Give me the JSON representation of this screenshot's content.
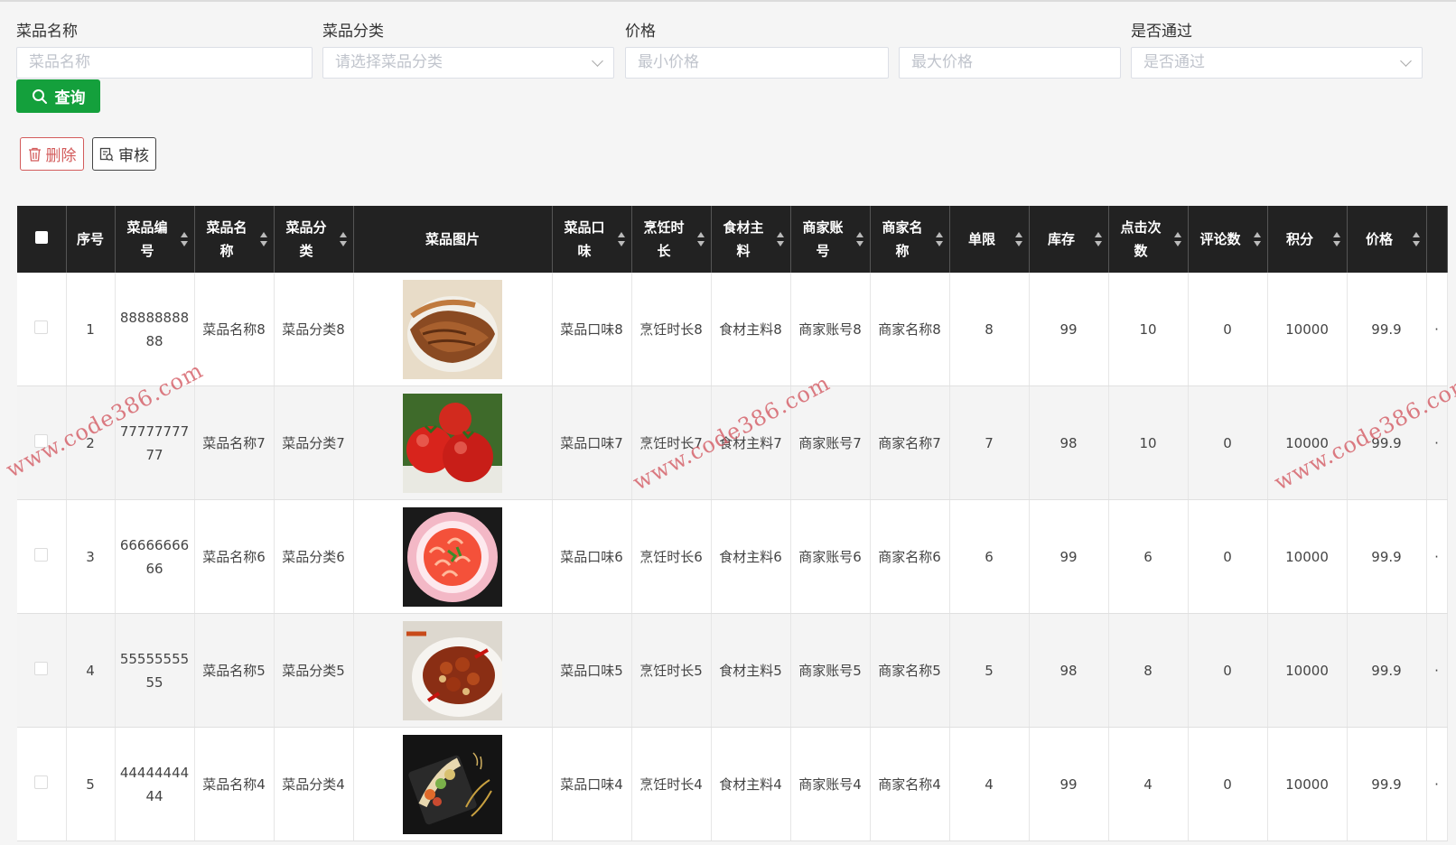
{
  "search": {
    "fields": [
      {
        "label": "菜品名称",
        "placeholder": "菜品名称"
      },
      {
        "label": "菜品分类",
        "placeholder": "请选择菜品分类"
      },
      {
        "label": "价格",
        "placeholder_min": "最小价格",
        "placeholder_max": "最大价格"
      },
      {
        "label": "是否通过",
        "placeholder": "是否通过"
      }
    ],
    "search_button": "查询"
  },
  "actions": {
    "delete": "删除",
    "audit": "审核"
  },
  "table": {
    "headers": [
      "序号",
      "菜品编号",
      "菜品名称",
      "菜品分类",
      "菜品图片",
      "菜品口味",
      "烹饪时长",
      "食材主料",
      "商家账号",
      "商家名称",
      "单限",
      "库存",
      "点击次数",
      "评论数",
      "积分",
      "价格"
    ],
    "rows": [
      {
        "index": "1",
        "code": "8888888888",
        "name": "菜品名称8",
        "category": "菜品分类8",
        "image": "roast-meat",
        "taste": "菜品口味8",
        "cook_time": "烹饪时长8",
        "ingredient": "食材主料8",
        "account": "商家账号8",
        "merchant": "商家名称8",
        "limit": "8",
        "stock": "99",
        "clicks": "10",
        "comments": "0",
        "points": "10000",
        "price": "99.9"
      },
      {
        "index": "2",
        "code": "7777777777",
        "name": "菜品名称7",
        "category": "菜品分类7",
        "image": "tomatoes",
        "taste": "菜品口味7",
        "cook_time": "烹饪时长7",
        "ingredient": "食材主料7",
        "account": "商家账号7",
        "merchant": "商家名称7",
        "limit": "7",
        "stock": "98",
        "clicks": "10",
        "comments": "0",
        "points": "10000",
        "price": "99.9"
      },
      {
        "index": "3",
        "code": "6666666666",
        "name": "菜品名称6",
        "category": "菜品分类6",
        "image": "shrimp-plate",
        "taste": "菜品口味6",
        "cook_time": "烹饪时长6",
        "ingredient": "食材主料6",
        "account": "商家账号6",
        "merchant": "商家名称6",
        "limit": "6",
        "stock": "99",
        "clicks": "6",
        "comments": "0",
        "points": "10000",
        "price": "99.9"
      },
      {
        "index": "4",
        "code": "5555555555",
        "name": "菜品名称5",
        "category": "菜品分类5",
        "image": "kung-pao-chicken",
        "taste": "菜品口味5",
        "cook_time": "烹饪时长5",
        "ingredient": "食材主料5",
        "account": "商家账号5",
        "merchant": "商家名称5",
        "limit": "5",
        "stock": "98",
        "clicks": "8",
        "comments": "0",
        "points": "10000",
        "price": "99.9"
      },
      {
        "index": "5",
        "code": "4444444444",
        "name": "菜品名称4",
        "category": "菜品分类4",
        "image": "plated-dish",
        "taste": "菜品口味4",
        "cook_time": "烹饪时长4",
        "ingredient": "食材主料4",
        "account": "商家账号4",
        "merchant": "商家名称4",
        "limit": "4",
        "stock": "99",
        "clicks": "4",
        "comments": "0",
        "points": "10000",
        "price": "99.9"
      }
    ]
  },
  "watermark": "www.code386.com",
  "colors": {
    "primary_green": "#14a03c",
    "danger": "#d35b5b",
    "header_bg": "#222222"
  }
}
